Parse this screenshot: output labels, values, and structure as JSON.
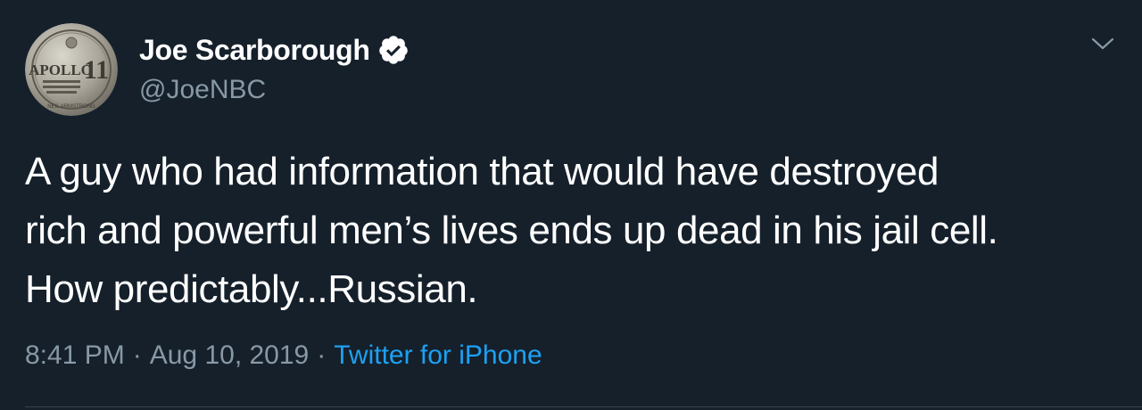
{
  "author": {
    "display_name": "Joe Scarborough",
    "handle": "@JoeNBC",
    "verified": true,
    "avatar_icon": "apollo-11-coin-avatar",
    "avatar_text": {
      "top": "APOLLO",
      "number": "11",
      "bottom": "NEIL ARMSTRONG"
    }
  },
  "tweet": {
    "lines": [
      "A guy who had information that would have destroyed",
      "rich and powerful men’s lives ends up dead in his jail cell.",
      "How predictably...Russian."
    ]
  },
  "meta": {
    "time": "8:41 PM",
    "separator": "·",
    "date": "Aug 10, 2019",
    "source": "Twitter for iPhone"
  },
  "colors": {
    "background": "#15202b",
    "secondary_text": "#8899a6",
    "link": "#1da1f2",
    "primary_text": "#ffffff"
  }
}
